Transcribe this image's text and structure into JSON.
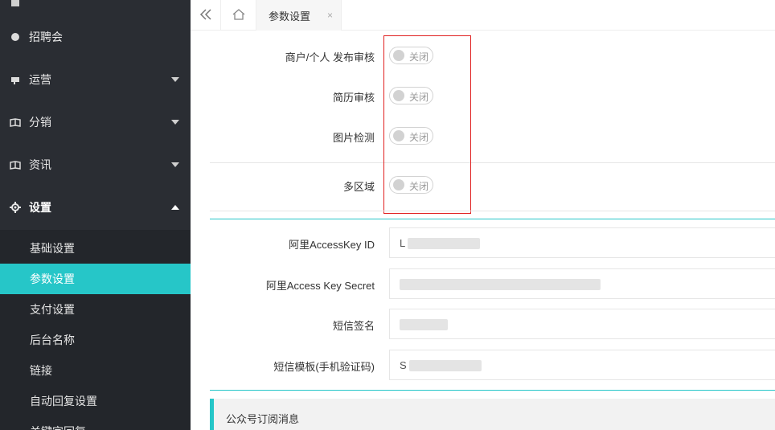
{
  "sidebar": {
    "items": [
      {
        "label": "招聘会",
        "icon": "circle-icon"
      },
      {
        "label": "运营",
        "icon": "megaphone-icon"
      },
      {
        "label": "分销",
        "icon": "book-icon"
      },
      {
        "label": "资讯",
        "icon": "book-icon"
      },
      {
        "label": "设置",
        "icon": "gear-icon"
      }
    ],
    "submenu": [
      {
        "label": "基础设置"
      },
      {
        "label": "参数设置",
        "active": true
      },
      {
        "label": "支付设置"
      },
      {
        "label": "后台名称"
      },
      {
        "label": "链接"
      },
      {
        "label": "自动回复设置"
      },
      {
        "label": "关键字回复"
      }
    ]
  },
  "tabbar": {
    "collapse_icon": "double-chevron-left-icon",
    "home_icon": "home-icon",
    "active_tab": "参数设置",
    "close_symbol": "×"
  },
  "settings": {
    "toggles": [
      {
        "label": "商户/个人 发布审核",
        "state": "关闭"
      },
      {
        "label": "简历审核",
        "state": "关闭"
      },
      {
        "label": "图片检测",
        "state": "关闭"
      },
      {
        "label": "多区域",
        "state": "关闭"
      }
    ],
    "fields": [
      {
        "label": "阿里AccessKey ID",
        "value": "L"
      },
      {
        "label": "阿里Access Key Secret",
        "value": ""
      },
      {
        "label": "短信签名",
        "value": ""
      },
      {
        "label": "短信模板(手机验证码)",
        "value": "S"
      }
    ],
    "section_title": "公众号订阅消息"
  },
  "colors": {
    "sidebar_bg": "#2a2d33",
    "accent": "#26c6c8",
    "highlight_border": "#e02020"
  }
}
